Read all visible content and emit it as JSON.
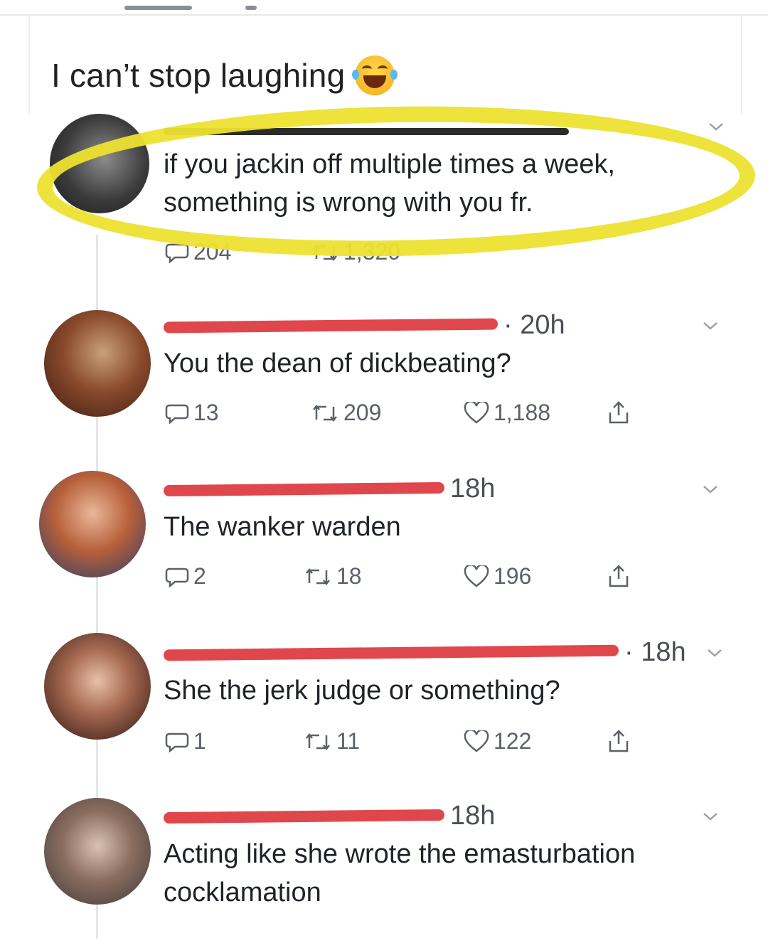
{
  "caption": {
    "text": "I can’t stop laughing",
    "emoji": "tears-of-joy-emoji"
  },
  "tweets": [
    {
      "text": "if you jackin off multiple times a week, something is wrong with you fr.",
      "replies": "204",
      "retweets": "1,320"
    },
    {
      "time": "· 20h",
      "text": "You the dean of dickbeating?",
      "replies": "13",
      "retweets": "209",
      "likes": "1,188"
    },
    {
      "time": "18h",
      "text": "The wanker warden",
      "replies": "2",
      "retweets": "18",
      "likes": "196"
    },
    {
      "time": "· 18h",
      "text": "She the jerk judge or something?",
      "replies": "1",
      "retweets": "11",
      "likes": "122"
    },
    {
      "time": "18h",
      "text_line1": "Acting like she wrote the emasturbation",
      "text_line2": "cocklamation"
    }
  ],
  "colors": {
    "highlight": "#ece12f",
    "redaction": "#e0474c",
    "icon": "#5b6168"
  }
}
